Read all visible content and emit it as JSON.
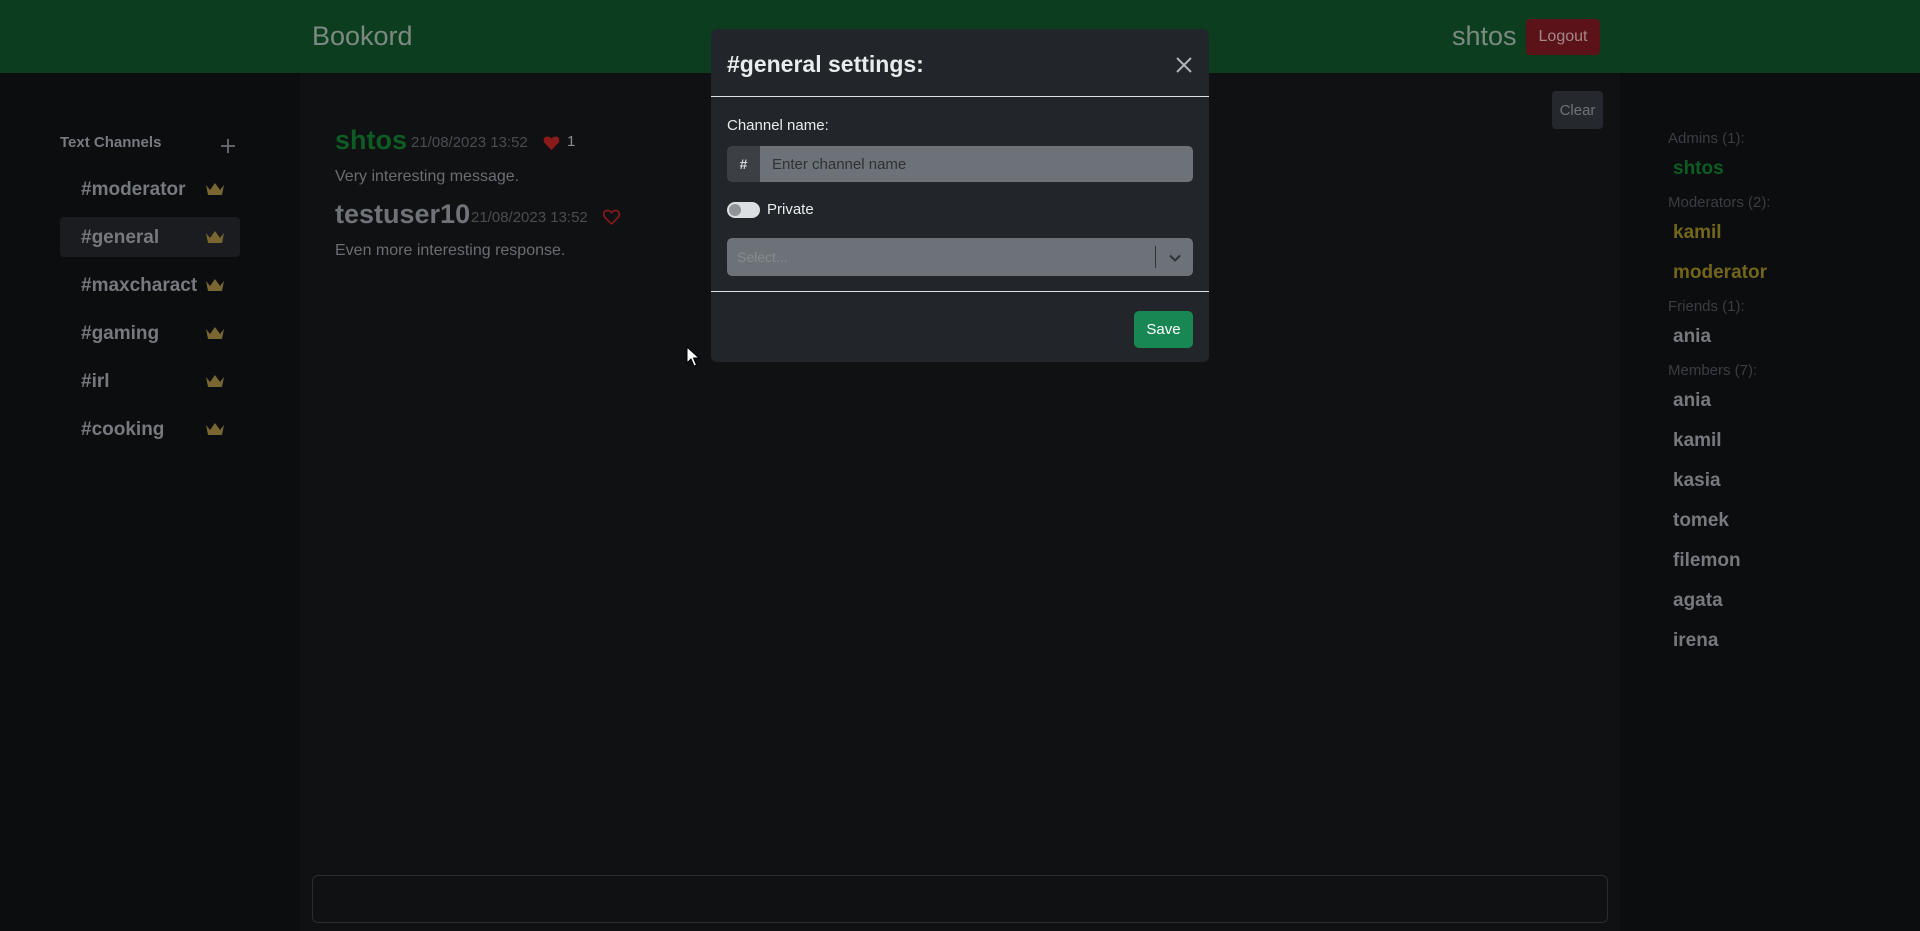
{
  "header": {
    "brand": "Bookord",
    "username": "shtos",
    "logout_label": "Logout"
  },
  "sidebar": {
    "title": "Text Channels",
    "channels": [
      {
        "label": "#moderator"
      },
      {
        "label": "#general"
      },
      {
        "label": "#maxcharact"
      },
      {
        "label": "#gaming"
      },
      {
        "label": "#irl"
      },
      {
        "label": "#cooking"
      }
    ]
  },
  "chat": {
    "clear_label": "Clear",
    "messages": [
      {
        "author": "shtos",
        "time": "21/08/2023 13:52",
        "likes": "1",
        "text": "Very interesting message."
      },
      {
        "author": "testuser10",
        "time": "21/08/2023 13:52",
        "text": "Even more interesting response."
      }
    ]
  },
  "members": {
    "admins_title": "Admins (1):",
    "admins": [
      "shtos"
    ],
    "moderators_title": "Moderators (2):",
    "moderators": [
      "kamil",
      "moderator"
    ],
    "friends_title": "Friends (1):",
    "friends": [
      "ania"
    ],
    "members_title": "Members (7):",
    "members": [
      "ania",
      "kamil",
      "kasia",
      "tomek",
      "filemon",
      "agata",
      "irena"
    ]
  },
  "modal": {
    "title": "#general settings:",
    "channel_name_label": "Channel name:",
    "hash_prefix": "#",
    "channel_name_placeholder": "Enter channel name",
    "private_label": "Private",
    "select_placeholder": "Select...",
    "save_label": "Save"
  },
  "colors": {
    "navbar": "#0c3d1e",
    "admin_name": "#0e5c23",
    "moderator_name": "#73661a",
    "heart": "#8b1a1a",
    "crown": "#7a6631",
    "save_button": "#198754"
  }
}
